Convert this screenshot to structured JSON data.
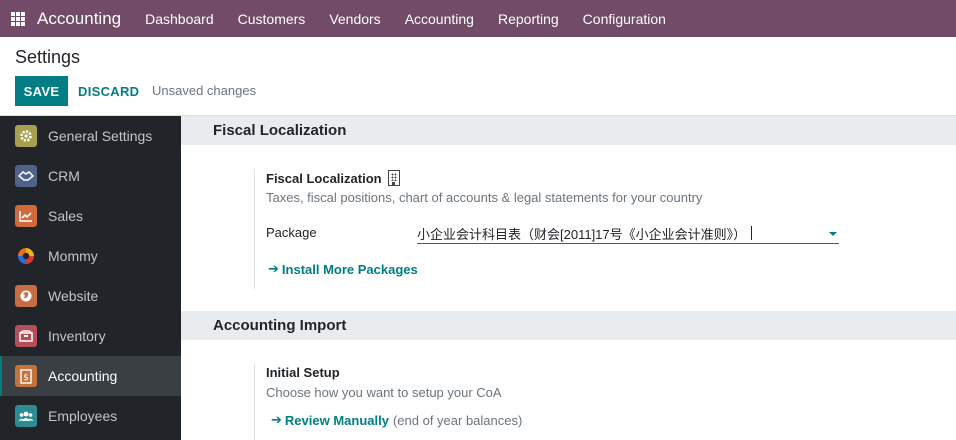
{
  "navbar": {
    "app_name": "Accounting",
    "menu": [
      "Dashboard",
      "Customers",
      "Vendors",
      "Accounting",
      "Reporting",
      "Configuration"
    ]
  },
  "control_panel": {
    "title": "Settings",
    "save_label": "SAVE",
    "discard_label": "DISCARD",
    "status": "Unsaved changes"
  },
  "sidebar": {
    "items": [
      {
        "label": "General Settings",
        "icon": "gear-icon",
        "color": "#a7a051"
      },
      {
        "label": "CRM",
        "icon": "handshake-icon",
        "color": "#4f6287"
      },
      {
        "label": "Sales",
        "icon": "chart-icon",
        "color": "#d06a3d"
      },
      {
        "label": "Mommy",
        "icon": "mommy-logo-icon",
        "color": "#e0392b"
      },
      {
        "label": "Website",
        "icon": "globe-icon",
        "color": "#c86d43"
      },
      {
        "label": "Inventory",
        "icon": "box-icon",
        "color": "#b44e59"
      },
      {
        "label": "Accounting",
        "icon": "dollar-doc-icon",
        "color": "#c3733e",
        "active": true
      },
      {
        "label": "Employees",
        "icon": "people-icon",
        "color": "#2c8c91"
      }
    ]
  },
  "fiscal_section": {
    "header": "Fiscal Localization",
    "title": "Fiscal Localization",
    "description": "Taxes, fiscal positions, chart of accounts & legal statements for your country",
    "package_label": "Package",
    "package_value": "小企业会计科目表（财会[2011]17号《小企业会计准则》）",
    "install_link": "Install More Packages"
  },
  "import_section": {
    "header": "Accounting Import",
    "title": "Initial Setup",
    "description": "Choose how you want to setup your CoA",
    "review_link": "Review Manually",
    "review_note": "(end of year balances)"
  }
}
